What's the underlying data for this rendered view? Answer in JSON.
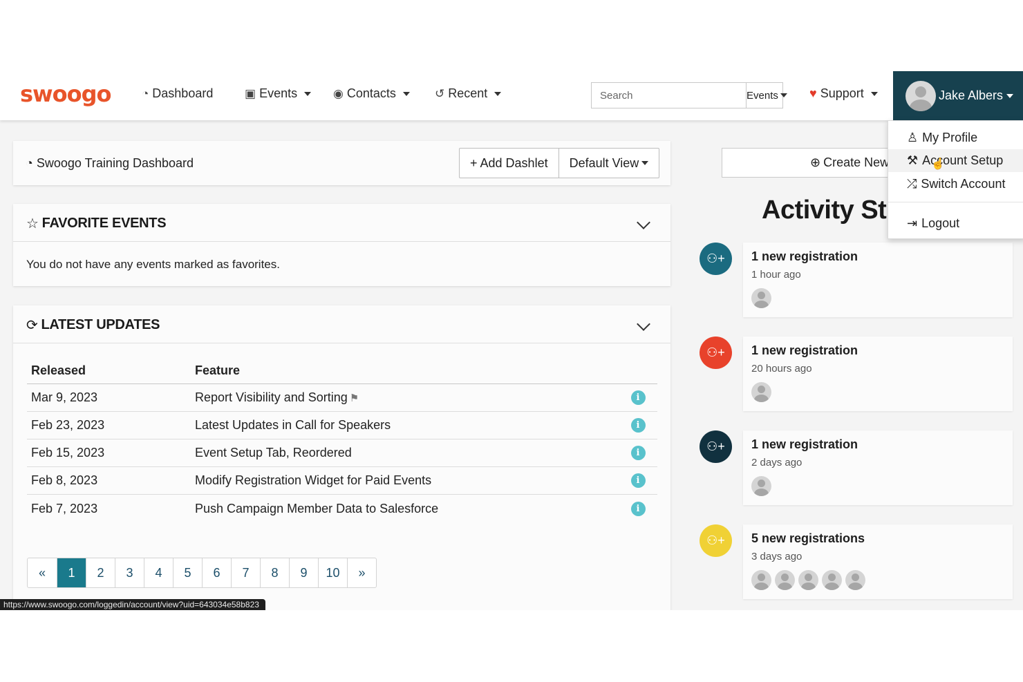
{
  "nav": {
    "logo": "swoogo",
    "dashboard": "Dashboard",
    "events": "Events",
    "contacts": "Contacts",
    "recent": "Recent",
    "search_placeholder": "Search",
    "search_scope": "Events",
    "support": "Support",
    "user_name": "Jake Albers",
    "icons": {
      "dashboard": "gauge-icon",
      "events": "calendar-check-icon",
      "contacts": "user-circle-icon",
      "recent": "history-icon",
      "support": "heart-icon"
    }
  },
  "user_menu": {
    "items": [
      {
        "label": "My Profile",
        "icon": "user-icon"
      },
      {
        "label": "Account Setup",
        "icon": "wrench-icon"
      },
      {
        "label": "Switch Account",
        "icon": "shuffle-icon"
      },
      {
        "label": "Logout",
        "icon": "logout-icon"
      }
    ],
    "hovered": "Account Setup"
  },
  "dashboard": {
    "title": "Swoogo Training Dashboard",
    "add_dashlet": "Add Dashlet",
    "default_view": "Default View"
  },
  "favorites": {
    "title": "FAVORITE EVENTS",
    "empty_message": "You do not have any events marked as favorites."
  },
  "updates": {
    "title": "LATEST UPDATES",
    "columns": [
      "Released",
      "Feature"
    ],
    "rows": [
      {
        "released": "Mar 9, 2023",
        "feature": "Report Visibility and Sorting"
      },
      {
        "released": "Feb 23, 2023",
        "feature": "Latest Updates in Call for Speakers"
      },
      {
        "released": "Feb 15, 2023",
        "feature": "Event Setup Tab, Reordered"
      },
      {
        "released": "Feb 8, 2023",
        "feature": "Modify Registration Widget for Paid Events"
      },
      {
        "released": "Feb 7, 2023",
        "feature": "Push Campaign Member Data to Salesforce"
      }
    ],
    "pagination": {
      "prev": "«",
      "next": "»",
      "pages": [
        "1",
        "2",
        "3",
        "4",
        "5",
        "6",
        "7",
        "8",
        "9",
        "10"
      ],
      "current": "1"
    }
  },
  "status_bar_url": "https://www.swoogo.com/loggedin/account/view?uid=643034e58b823",
  "right": {
    "create_label": "Create New",
    "activity_title": "Activity St",
    "items": [
      {
        "title": "1 new registration",
        "time": "1 hour ago",
        "avatars": 1,
        "color": "#1b6b80"
      },
      {
        "title": "1 new registration",
        "time": "20 hours ago",
        "avatars": 1,
        "color": "#e8422b"
      },
      {
        "title": "1 new registration",
        "time": "2 days ago",
        "avatars": 1,
        "color": "#11313f"
      },
      {
        "title": "5 new registrations",
        "time": "3 days ago",
        "avatars": 5,
        "color": "#f0d135"
      }
    ]
  },
  "colors": {
    "brand": "#e8542a",
    "nav_user_bg": "#17414f",
    "accent": "#1a7a8c",
    "info": "#59c2cc"
  }
}
